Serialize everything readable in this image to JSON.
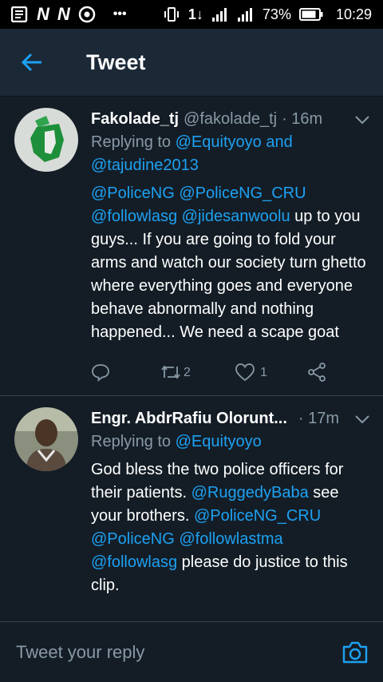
{
  "statusbar": {
    "battery": "73%",
    "time": "10:29"
  },
  "appbar": {
    "title": "Tweet"
  },
  "tweets": [
    {
      "name": "Fakolade_tj",
      "handle": "@fakolade_tj",
      "time": "· 16m",
      "reply_prefix": "Replying to ",
      "reply_to_1": "@Equityoyo and",
      "reply_to_2": "@tajudine2013",
      "mentions": "@PoliceNG @PoliceNG_CRU @followlasg @jidesanwoolu",
      "text": " up to you guys... If you are going to fold your arms and watch our society turn ghetto where everything goes and everyone behave abnormally and nothing happened... We need a scape goat",
      "retweets": "2",
      "likes": "1"
    },
    {
      "name": "Engr. AbdrRafiu Olorunt...",
      "time": "· 17m",
      "reply_prefix": "Replying to ",
      "reply_to": "@Equityoyo",
      "text1": "God bless the two police officers for their patients. ",
      "mention1": "@RuggedyBaba",
      "text2": " see your brothers. ",
      "mention2": "@PoliceNG_CRU @PoliceNG @followlastma @followlasg",
      "text3": " please do justice to this clip."
    }
  ],
  "composer": {
    "placeholder": "Tweet your reply"
  },
  "colors": {
    "background": "#141d26",
    "accent": "#1da1f2",
    "muted": "#8899a6"
  },
  "icons": [
    "back-arrow-icon",
    "chevron-down-icon",
    "reply-icon",
    "retweet-icon",
    "like-icon",
    "share-icon",
    "camera-icon"
  ]
}
